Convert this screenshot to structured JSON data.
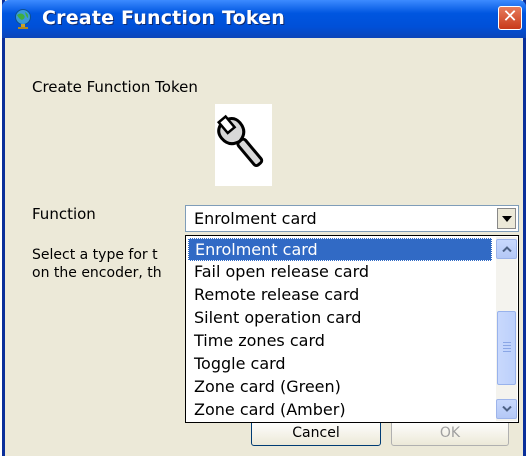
{
  "window": {
    "title": "Create Function Token",
    "icon": "globe-app-icon",
    "close_icon": "close-icon"
  },
  "content": {
    "heading": "Create Function Token",
    "token_image": "wrench-icon"
  },
  "function": {
    "label": "Function",
    "selected_value": "Enrolment card",
    "options": [
      "Enrolment card",
      "Fail open release card",
      "Remote release card",
      "Silent operation card",
      "Time zones card",
      "Toggle card",
      "Zone card (Green)",
      "Zone card (Amber)"
    ],
    "selected_index": 0
  },
  "description": {
    "line1": "Select a type for t",
    "line2": "on the encoder, th"
  },
  "buttons": {
    "cancel": "Cancel",
    "ok": "OK"
  },
  "colors": {
    "title_bar": "#0054e3",
    "selection": "#316ac5",
    "close_button": "#d7532e",
    "dialog_bg": "#ece9d8"
  }
}
